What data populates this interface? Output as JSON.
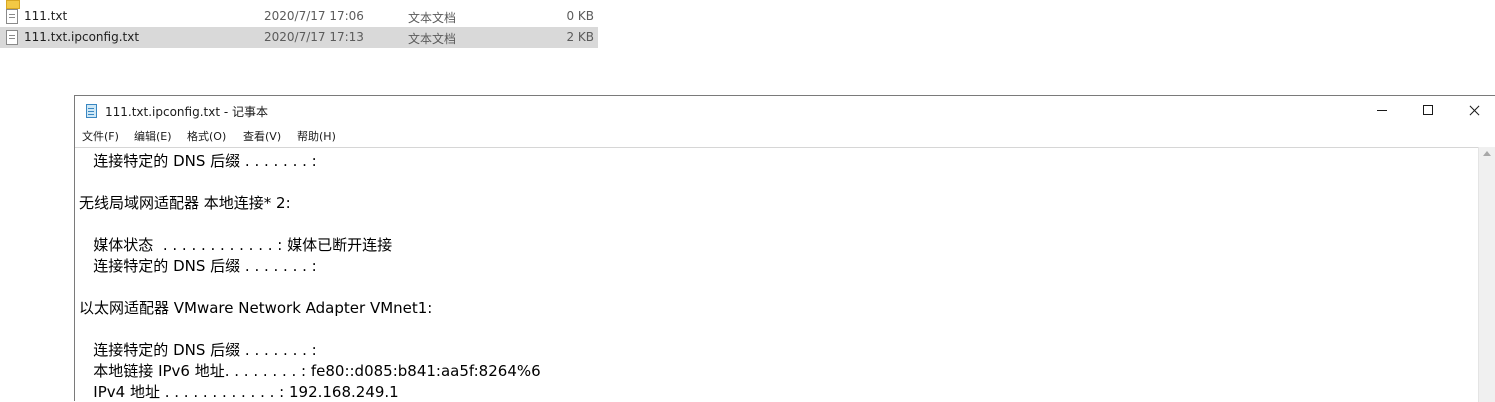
{
  "explorer": {
    "files": [
      {
        "name": "111.txt",
        "modified": "2020/7/17 17:06",
        "type": "文本文档",
        "size": "0 KB"
      },
      {
        "name": "111.txt.ipconfig.txt",
        "modified": "2020/7/17 17:13",
        "type": "文本文档",
        "size": "2 KB",
        "selected": true
      }
    ]
  },
  "notepad": {
    "title": "111.txt.ipconfig.txt - 记事本",
    "menu": [
      "文件(F)",
      "编辑(E)",
      "格式(O)",
      "查看(V)",
      "帮助(H)"
    ],
    "lines": [
      "   连接特定的 DNS 后缀 . . . . . . . :",
      "无线局域网适配器 本地连接* 2:",
      "   媒体状态  . . . . . . . . . . . . : 媒体已断开连接",
      "   连接特定的 DNS 后缀 . . . . . . . :",
      "以太网适配器 VMware Network Adapter VMnet1:",
      "   连接特定的 DNS 后缀 . . . . . . . :",
      "   本地链接 IPv6 地址. . . . . . . . : fe80::d085:b841:aa5f:8264%6",
      "   IPv4 地址 . . . . . . . . . . . . : 192.168.249.1"
    ]
  },
  "colors": {
    "selected_row": "#d9d9d9",
    "notepad_icon": "#3a87c2",
    "folder_icon": "#f3c945"
  }
}
